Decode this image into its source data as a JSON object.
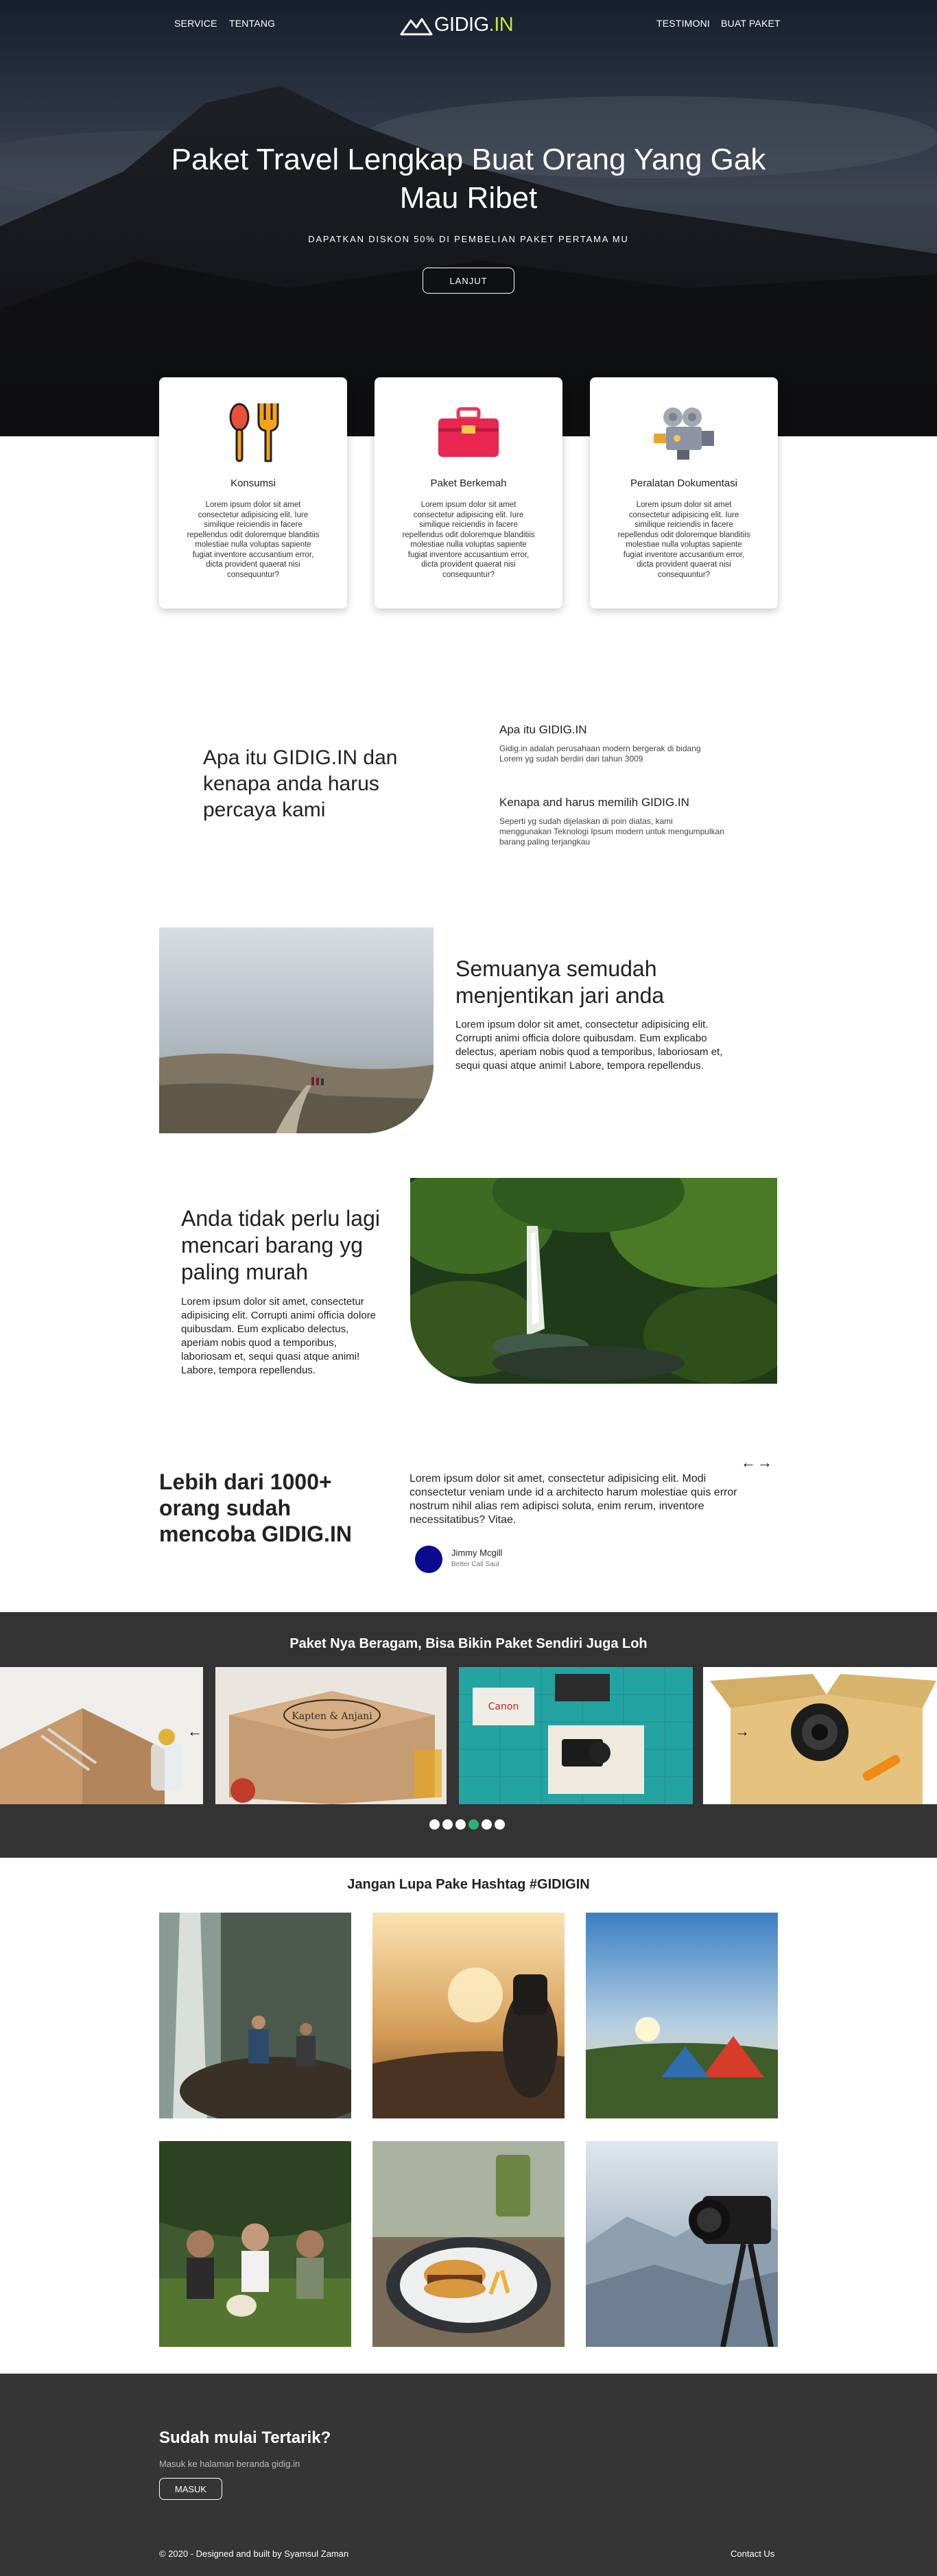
{
  "nav": {
    "left": [
      "SERVICE",
      "TENTANG"
    ],
    "right": [
      "TESTIMONI",
      "BUAT PAKET"
    ],
    "logo_main": "GIDIG",
    "logo_accent": ".IN"
  },
  "hero": {
    "title": "Paket Travel Lengkap Buat Orang Yang Gak Mau Ribet",
    "subtitle": "DAPATKAN DISKON 50% DI PEMBELIAN PAKET PERTAMA MU",
    "button": "LANJUT"
  },
  "services": [
    {
      "icon": "spoon-fork-icon",
      "title": "Konsumsi",
      "text": "Lorem ipsum dolor sit amet consectetur adipisicing elit. Iure similique reiciendis in facere repellendus odit doloremque blanditiis molestiae nulla voluptas sapiente fugiat inventore accusantium error, dicta provident quaerat nisi consequuntur?"
    },
    {
      "icon": "toolbox-icon",
      "title": "Paket Berkemah",
      "text": "Lorem ipsum dolor sit amet consectetur adipisicing elit. Iure similique reiciendis in facere repellendus odit doloremque blanditiis molestiae nulla voluptas sapiente fugiat inventore accusantium error, dicta provident quaerat nisi consequuntur?"
    },
    {
      "icon": "video-camera-icon",
      "title": "Peralatan Dokumentasi",
      "text": "Lorem ipsum dolor sit amet consectetur adipisicing elit. Iure similique reiciendis in facere repellendus odit doloremque blanditiis molestiae nulla voluptas sapiente fugiat inventore accusantium error, dicta provident quaerat nisi consequuntur?"
    }
  ],
  "why": {
    "title": "Apa itu GIDIG.IN dan kenapa anda harus percaya kami",
    "q1_title": "Apa itu GIDIG.IN",
    "q1_text": "Gidig.in adalah perusahaan modern bergerak di bidang Lorem yg sudah berdiri dari tahun 3009",
    "q2_title": "Kenapa and harus memilih GIDIG.IN",
    "q2_text": "Seperti yg sudah dijelaskan di poin diatas, kami menggunakan Teknologi Ipsum modern untuk mengumpulkan barang paling terjangkau"
  },
  "feature1": {
    "title": "Semuanya semudah menjentikan jari anda",
    "text": "Lorem ipsum dolor sit amet, consectetur adipisicing elit. Corrupti animi officia dolore quibusdam. Eum explicabo delectus, aperiam nobis quod a temporibus, laboriosam et, sequi quasi atque animi! Labore, tempora repellendus."
  },
  "feature2": {
    "title": "Anda tidak perlu lagi mencari barang yg paling murah",
    "text": "Lorem ipsum dolor sit amet, consectetur adipisicing elit. Corrupti animi officia dolore quibusdam. Eum explicabo delectus, aperiam nobis quod a temporibus, laboriosam et, sequi quasi atque animi! Labore, tempora repellendus."
  },
  "testimonial": {
    "head_pre": "Lebih dari ",
    "head_bold": "1000+",
    "head_post": " orang sudah mencoba GIDIG.IN",
    "quote": "Lorem ipsum dolor sit amet, consectetur adipisicing elit. Modi consectetur veniam unde id a architecto harum molestiae quis error nostrum nihil alias rem adipisci soluta, enim rerum, inventore necessitatibus? Vitae.",
    "name": "Jimmy Mcgill",
    "role": "Better Call Saul",
    "prev": "←",
    "next": "→"
  },
  "packages": {
    "title": "Paket Nya Beragam, Bisa Bikin Paket Sendiri Juga Loh",
    "box_label_1": "Kapten & Anjani",
    "box_label_2": "Canon",
    "prev": "←",
    "next": "→",
    "active_dot": 3,
    "dot_count": 6
  },
  "hashtag": {
    "title": "Jangan Lupa Pake Hashtag #GIDIGIN"
  },
  "footer": {
    "heading": "Sudah mulai Tertarik?",
    "text": "Masuk ke halaman beranda gidig.in",
    "button": "MASUK",
    "copyright": "© 2020 - Designed and built by Syamsul Zaman",
    "contact": "Contact Us"
  },
  "colors": {
    "accent": "#c7e636",
    "dark_section": "#333333",
    "active_dot": "#27b47a",
    "avatar": "#0a0a8e"
  }
}
